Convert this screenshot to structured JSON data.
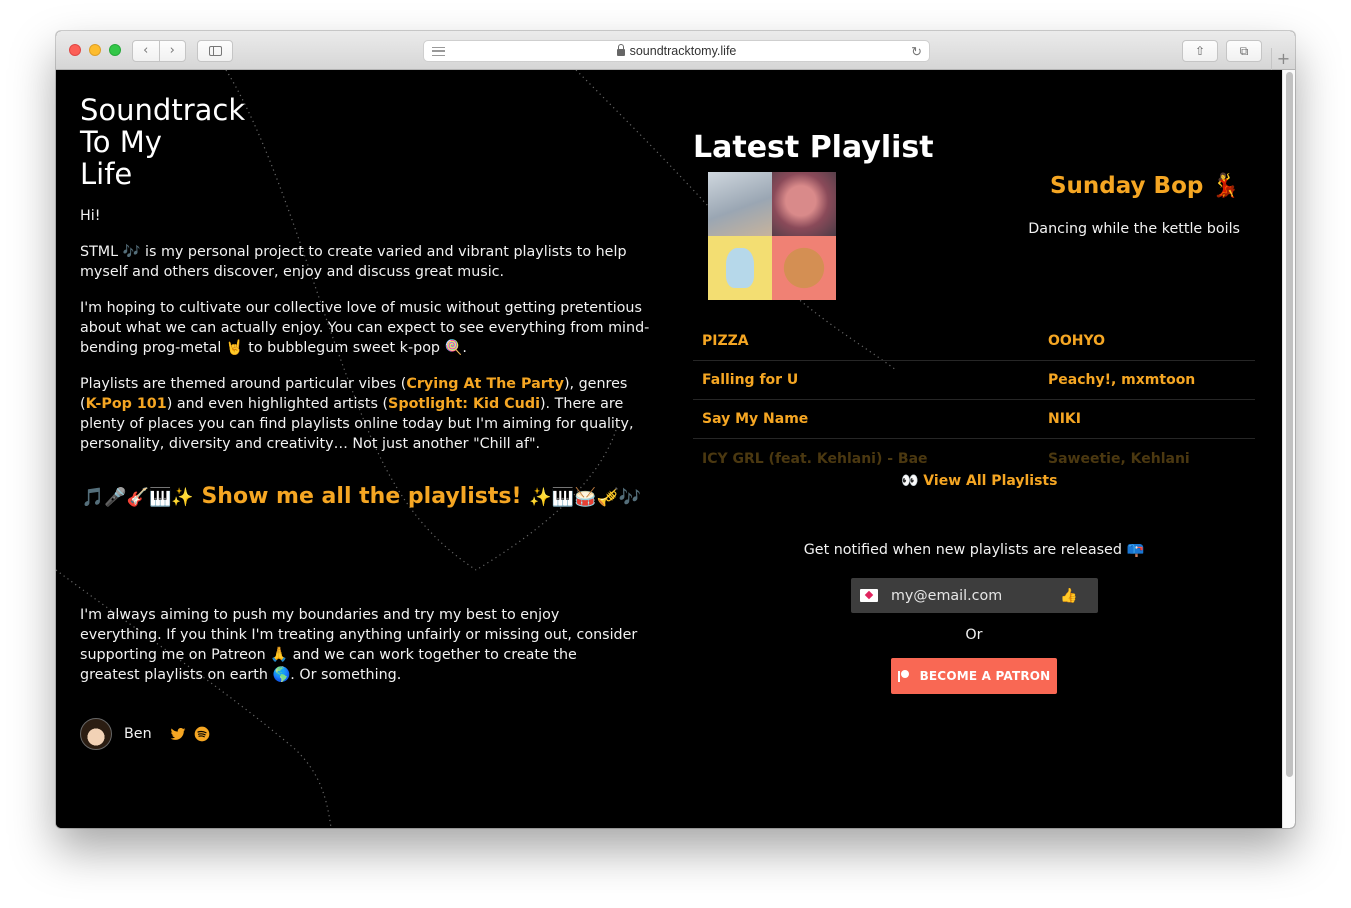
{
  "browser": {
    "url": "soundtracktomy.life",
    "back_glyph": "‹",
    "forward_glyph": "›",
    "reload_glyph": "↻",
    "share_glyph": "⇧",
    "tabs_glyph": "⧉",
    "new_tab_glyph": "+"
  },
  "brand": {
    "line1": "Soundtrack",
    "line2": "To My",
    "line3": "Life"
  },
  "intro": {
    "greeting": "Hi!",
    "p1_a": "STML 🎶 is my personal project to create varied and vibrant playlists to help myself and others discover, enjoy and discuss great music.",
    "p2": "I'm hoping to cultivate our collective love of music without getting pretentious about what we can actually enjoy. You can expect to see everything from mind-bending prog-metal 🤘 to bubblegum sweet k-pop 🍭.",
    "p3_a": "Playlists are themed around particular vibes (",
    "p3_link1": "Crying At The Party",
    "p3_b": "), genres (",
    "p3_link2": "K-Pop 101",
    "p3_c": ") and even highlighted artists (",
    "p3_link3": "Spotlight: Kid Cudi",
    "p3_d": "). There are plenty of places you can find playlists online today but I'm aiming for quality, personality, diversity and creativity… Not just another \"Chill af\"."
  },
  "cta": {
    "emoji_left": "🎵🎤🎸🎹✨",
    "label": "Show me all the playlists!",
    "emoji_right": "✨🎹🥁🎺🎶"
  },
  "outro": "I'm always aiming to push my boundaries and try my best to enjoy everything. If you think I'm treating anything unfairly or missing out, consider supporting me on Patreon 🙏 and we can work together to create the greatest playlists on earth 🌎. Or something.",
  "author": {
    "name": "Ben"
  },
  "latest": {
    "heading": "Latest Playlist",
    "playlist_name": "Sunday Bop 💃",
    "playlist_desc": "Dancing while the kettle boils",
    "tracks": [
      {
        "name": "PIZZA",
        "artist": "OOHYO"
      },
      {
        "name": "Falling for U",
        "artist": "Peachy!, mxmtoon"
      },
      {
        "name": "Say My Name",
        "artist": "NIKI"
      },
      {
        "name": "ICY GRL (feat. Kehlani) - Bae",
        "artist": "Saweetie, Kehlani"
      }
    ],
    "view_all": "👀 View All Playlists"
  },
  "signup": {
    "prompt": "Get notified when new playlists are released 📪",
    "email_placeholder": "my@email.com",
    "submit_glyph": "👍",
    "or": "Or",
    "patron_label": "BECOME A PATRON"
  },
  "colors": {
    "accent": "#f5a623",
    "patreon": "#f96854",
    "background": "#000000"
  }
}
